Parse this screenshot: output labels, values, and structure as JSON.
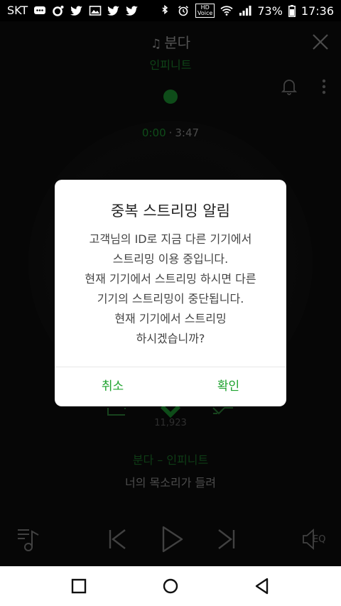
{
  "status_bar": {
    "carrier": "SKT",
    "icons_left": [
      "chat-icon",
      "app-icon",
      "twitter-icon",
      "image-icon",
      "twitter-icon",
      "twitter-icon"
    ],
    "hd_label": "HD",
    "voice_label": "Voice",
    "battery": "73%",
    "time": "17:36"
  },
  "player": {
    "song_title": "분다",
    "artist": "인피니트",
    "time_current": "0:00",
    "time_separator": "·",
    "time_total": "3:47",
    "likes": "11,923",
    "now_title": "분다 – 인피니트",
    "lyric": "너의 목소리가 들려",
    "eq_label": "EQ",
    "colors": {
      "accent": "#1b8a2e",
      "background": "#0c0c0c"
    }
  },
  "dialog": {
    "title": "중복 스트리밍 알림",
    "body_lines": [
      "고객님의 ID로 지금 다른 기기에서",
      "스트리밍 이용 중입니다.",
      "현재 기기에서 스트리밍 하시면 다른",
      "기기의 스트리밍이 중단됩니다.",
      "현재 기기에서 스트리밍",
      "하시겠습니까?"
    ],
    "cancel_label": "취소",
    "confirm_label": "확인",
    "button_color": "#1fa32f"
  },
  "nav_bar": {
    "buttons": [
      "recents-icon",
      "home-icon",
      "back-icon"
    ]
  }
}
